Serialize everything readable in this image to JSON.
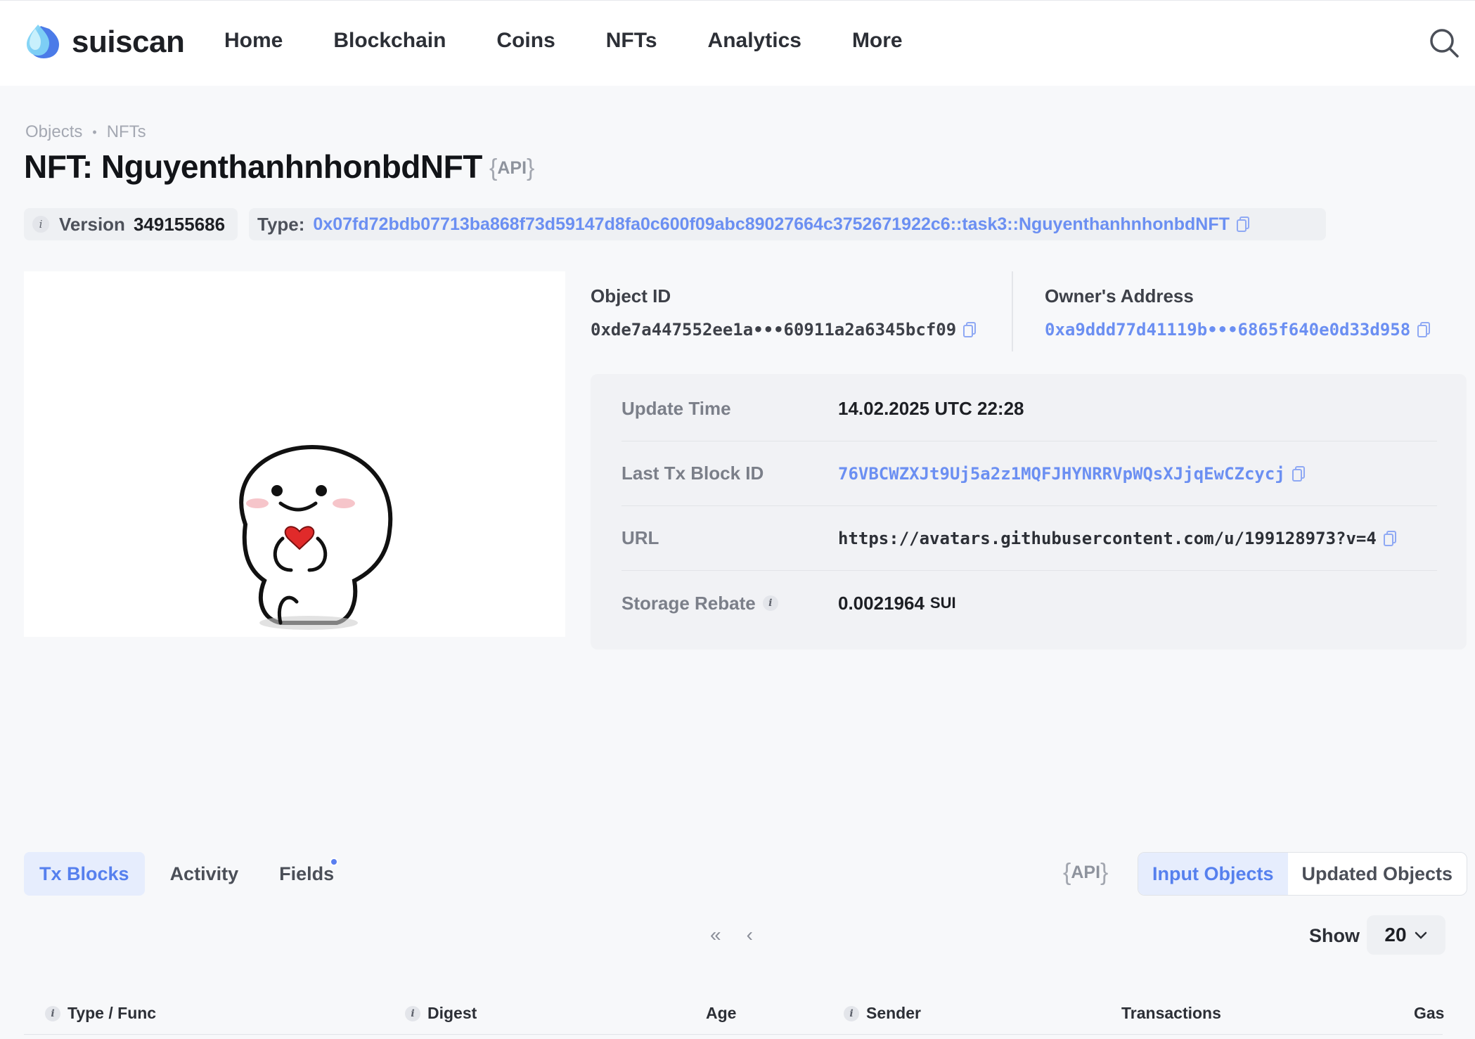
{
  "header": {
    "logo_text": "suiscan",
    "nav": [
      "Home",
      "Blockchain",
      "Coins",
      "NFTs",
      "Analytics",
      "More"
    ]
  },
  "breadcrumb": [
    "Objects",
    "NFTs"
  ],
  "page": {
    "title": "NFT: NguyenthanhnhonbdNFT",
    "api_label": "API"
  },
  "chips": {
    "version_label": "Version",
    "version_value": "349155686",
    "type_label": "Type:",
    "type_value": "0x07fd72bdb07713ba868f73d59147d8fa0c600f09abc89027664c3752671922c6::task3::NguyenthanhnhonbdNFT"
  },
  "object": {
    "id_label": "Object ID",
    "id_value": "0xde7a447552ee1a•••60911a2a6345bcf09",
    "owner_label": "Owner's Address",
    "owner_value": "0xa9ddd77d41119b•••6865f640e0d33d958"
  },
  "details": {
    "update_time_label": "Update Time",
    "update_time_value": "14.02.2025 UTC 22:28",
    "last_tx_label": "Last Tx Block ID",
    "last_tx_value": "76VBCWZXJt9Uj5a2z1MQFJHYNRRVpWQsXJjqEwCZcycj",
    "url_label": "URL",
    "url_value": "https://avatars.githubusercontent.com/u/199128973?v=4",
    "storage_label": "Storage Rebate",
    "storage_value": "0.0021964",
    "storage_unit": "SUI"
  },
  "tabs": [
    {
      "label": "Tx Blocks",
      "active": true
    },
    {
      "label": "Activity",
      "active": false
    },
    {
      "label": "Fields",
      "active": false
    }
  ],
  "api_label2": "API",
  "segment": {
    "input_objects": "Input Objects",
    "updated_objects": "Updated Objects"
  },
  "pagination": {
    "first": "«",
    "prev": "‹",
    "show_label": "Show",
    "page_size": "20"
  },
  "table": {
    "columns": [
      "Type / Func",
      "Digest",
      "Age",
      "Sender",
      "Transactions",
      "Gas"
    ]
  },
  "colors": {
    "accent": "#5680ee",
    "link": "#6b8ff2"
  }
}
